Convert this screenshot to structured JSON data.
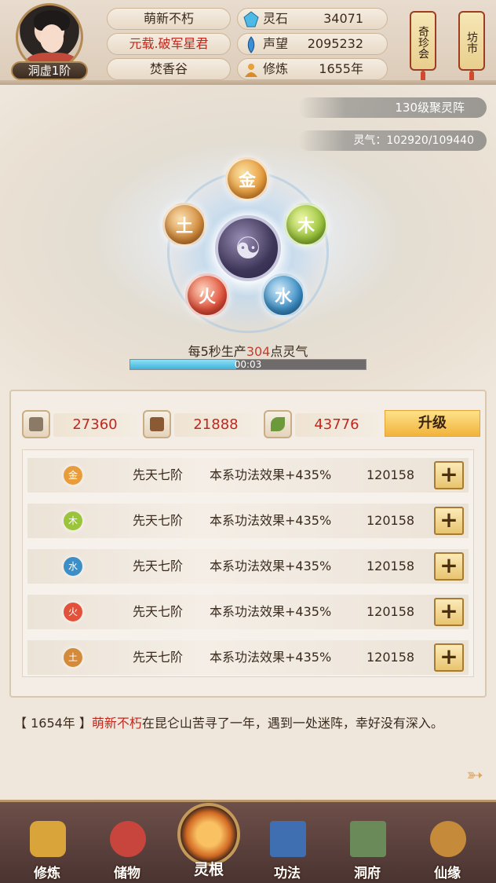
{
  "header": {
    "player_name": "萌新不朽",
    "title": "元载.破军星君",
    "sect": "焚香谷",
    "realm": "洞虚1阶",
    "stats": [
      {
        "icon": "spirit-stone-icon",
        "label": "灵石",
        "value": "34071"
      },
      {
        "icon": "reputation-icon",
        "label": "声望",
        "value": "2095232"
      },
      {
        "icon": "cultivation-icon",
        "label": "修炼",
        "value": "1655年"
      }
    ],
    "lanterns": [
      {
        "label": "奇珍会"
      },
      {
        "label": "坊市"
      }
    ]
  },
  "array": {
    "level_label": "130级聚灵阵",
    "qi_label": "灵气：102920/109440",
    "center_symbol": "☯",
    "elements": [
      {
        "key": "jin",
        "label": "金"
      },
      {
        "key": "mu",
        "label": "木"
      },
      {
        "key": "shui",
        "label": "水"
      },
      {
        "key": "huo",
        "label": "火"
      },
      {
        "key": "tu",
        "label": "土"
      }
    ],
    "production_prefix": "每5秒生产",
    "production_value": "304",
    "production_suffix": "点灵气",
    "timer": "00:03",
    "timer_progress": 0.45
  },
  "resources": [
    {
      "icon": "scroll-icon",
      "value": "27360"
    },
    {
      "icon": "wood-icon",
      "value": "21888"
    },
    {
      "icon": "herb-icon",
      "value": "43776"
    }
  ],
  "upgrade_label": "升级",
  "roots": [
    {
      "element": "金",
      "color": "#e99c3b",
      "level": "先天七阶",
      "effect": "本系功法效果+435%",
      "cost": "120158"
    },
    {
      "element": "木",
      "color": "#9ac43a",
      "level": "先天七阶",
      "effect": "本系功法效果+435%",
      "cost": "120158"
    },
    {
      "element": "水",
      "color": "#3c8fc6",
      "level": "先天七阶",
      "effect": "本系功法效果+435%",
      "cost": "120158"
    },
    {
      "element": "火",
      "color": "#e2513a",
      "level": "先天七阶",
      "effect": "本系功法效果+435%",
      "cost": "120158"
    },
    {
      "element": "土",
      "color": "#d38b3b",
      "level": "先天七阶",
      "effect": "本系功法效果+435%",
      "cost": "120158"
    }
  ],
  "plus_symbol": "+",
  "log": {
    "year": "【 1654年 】",
    "name": "萌新不朽",
    "text": "在昆仑山苦寻了一年，遇到一处迷阵，幸好没有深入。"
  },
  "nav": [
    {
      "label": "修炼",
      "icon": "cultivate-icon",
      "color": "#d9a53a"
    },
    {
      "label": "储物",
      "icon": "bag-icon",
      "color": "#c8453d"
    },
    {
      "label": "灵根",
      "icon": "spirit-root-icon",
      "color": "#e07a2a"
    },
    {
      "label": "功法",
      "icon": "book-icon",
      "color": "#3f6fb0"
    },
    {
      "label": "洞府",
      "icon": "cave-icon",
      "color": "#6a8a5a"
    },
    {
      "label": "仙缘",
      "icon": "gourd-icon",
      "color": "#c58a3a"
    }
  ]
}
